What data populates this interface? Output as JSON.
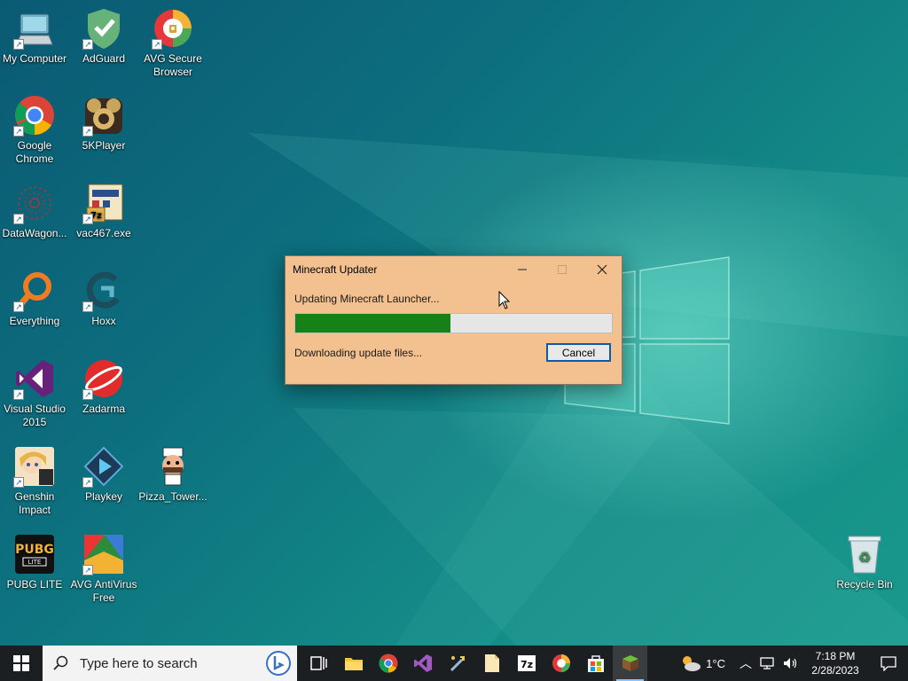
{
  "desktop": {
    "icons": [
      {
        "label": "My Computer",
        "icon": "computer-icon"
      },
      {
        "label": "AdGuard",
        "icon": "adguard-icon"
      },
      {
        "label": "AVG Secure Browser",
        "icon": "avg-browser-icon"
      },
      {
        "label": "Google Chrome",
        "icon": "chrome-icon"
      },
      {
        "label": "5KPlayer",
        "icon": "5kplayer-icon"
      },
      {
        "label": "DataWagon...",
        "icon": "datawagon-icon"
      },
      {
        "label": "vac467.exe",
        "icon": "vac467-icon"
      },
      {
        "label": "Everything",
        "icon": "everything-icon"
      },
      {
        "label": "Hoxx",
        "icon": "hoxx-icon"
      },
      {
        "label": "Visual Studio 2015",
        "icon": "visual-studio-icon"
      },
      {
        "label": "Zadarma",
        "icon": "zadarma-icon"
      },
      {
        "label": "Genshin Impact",
        "icon": "genshin-icon"
      },
      {
        "label": "Playkey",
        "icon": "playkey-icon"
      },
      {
        "label": "Pizza_Tower...",
        "icon": "pizza-tower-icon"
      },
      {
        "label": "PUBG LITE",
        "icon": "pubg-icon"
      },
      {
        "label": "AVG AntiVirus Free",
        "icon": "avg-antivirus-icon"
      },
      {
        "label": "Recycle Bin",
        "icon": "recycle-bin-icon"
      }
    ]
  },
  "dialog": {
    "title": "Minecraft Updater",
    "status_top": "Updating Minecraft Launcher...",
    "progress": 0.49,
    "status_bottom": "Downloading update files...",
    "cancel_label": "Cancel",
    "progress_color": "#168116"
  },
  "taskbar": {
    "search_placeholder": "Type here to search",
    "apps": [
      "task-view-icon",
      "file-explorer-icon",
      "chrome-icon",
      "visual-studio-icon",
      "tool-icon",
      "notepad-icon",
      "7zip-icon",
      "avg-browser-icon",
      "store-icon",
      "minecraft-icon"
    ],
    "weather": "1°C",
    "time": "7:18 PM",
    "date": "2/28/2023"
  }
}
